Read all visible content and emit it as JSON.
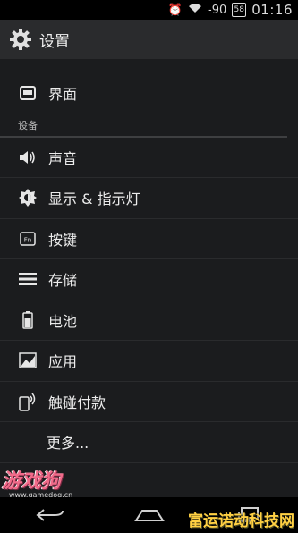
{
  "status_bar": {
    "signal_text": "-90",
    "battery_level": "58",
    "time": "01:16"
  },
  "action_bar": {
    "title": "设置"
  },
  "settings": {
    "top_item": "界面",
    "section_header": "设备",
    "device_items": [
      {
        "label": "声音",
        "icon": "volume-icon"
      },
      {
        "label": "显示 & 指示灯",
        "icon": "brightness-icon"
      },
      {
        "label": "按键",
        "icon": "fn-key-icon"
      },
      {
        "label": "存储",
        "icon": "storage-icon"
      },
      {
        "label": "电池",
        "icon": "battery-icon"
      },
      {
        "label": "应用",
        "icon": "apps-icon"
      },
      {
        "label": "触碰付款",
        "icon": "tap-pay-icon"
      }
    ],
    "more_label": "更多..."
  },
  "watermarks": {
    "left_logo_text": "游戏狗",
    "left_url": "www.gamedog.cn",
    "right_text": "富运诺动科技网"
  },
  "colors": {
    "background": "#1b1c1e",
    "action_bar": "#2a2b2d",
    "status_bar": "#000000",
    "text": "#ececec"
  }
}
